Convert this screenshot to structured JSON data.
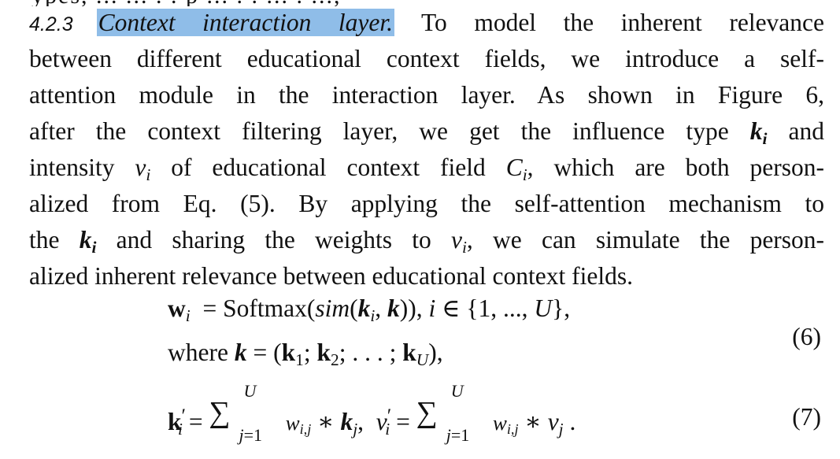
{
  "section": {
    "number": "4.2.3",
    "title": "Context interaction layer."
  },
  "lines": [
    "To model the inherent relevance",
    "between different educational context fields, we introduce a self-",
    "attention module in the interaction layer. As shown in Figure 6,",
    "after the context filtering layer, we get the influence type",
    "and",
    "intensity",
    "of educational context field",
    ", which are both person-",
    "alized from Eq. (5). By applying the self-attention mechanism to",
    "the",
    "and sharing the weights to",
    ", we can simulate the person-",
    "alized inherent relevance between educational context fields."
  ],
  "equations": {
    "eq6_line1": "= Softmax(sim(k_i, k)), i ∈ {1, ..., U},",
    "eq6_where": "where",
    "eq6_number": "(6)",
    "eq7_number": "(7)"
  }
}
